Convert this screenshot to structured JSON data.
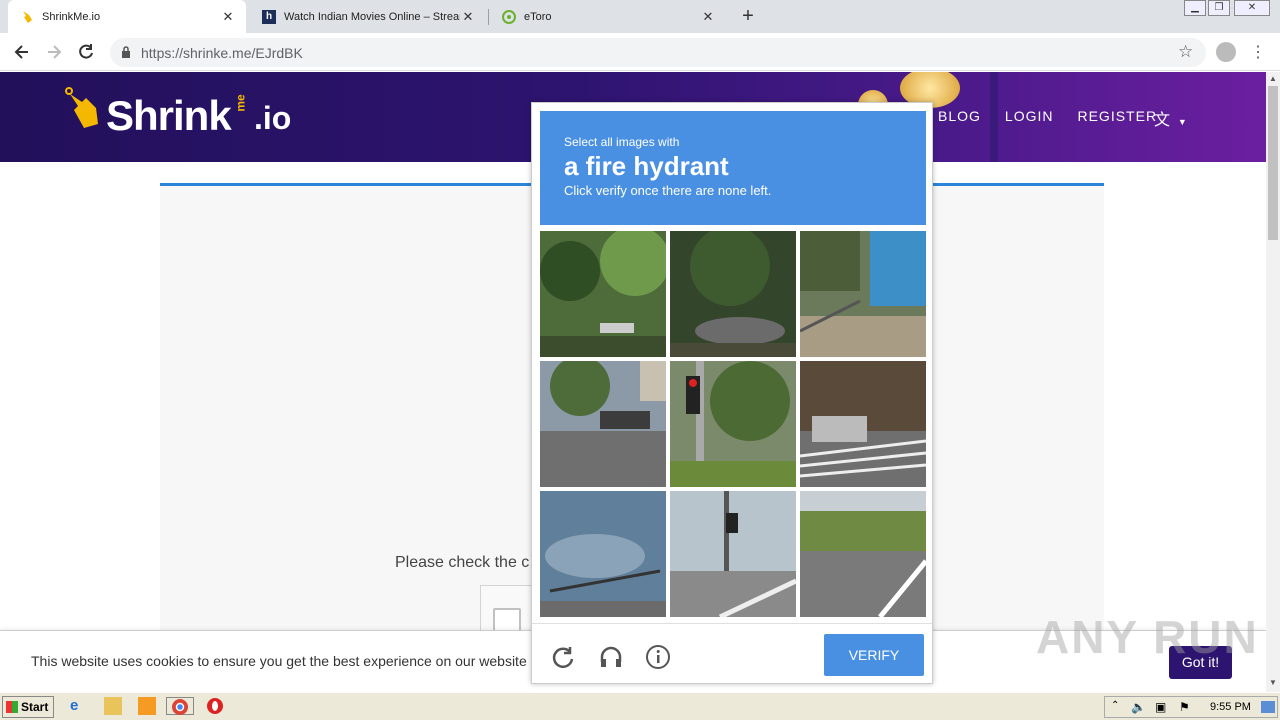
{
  "browser": {
    "tabs": [
      {
        "title": "ShrinkMe.io",
        "active": true
      },
      {
        "title": "Watch Indian Movies Online – Stream",
        "active": false
      },
      {
        "title": "eToro",
        "active": false
      }
    ],
    "url_host": "https://shrinke.me",
    "url_path": "/EJrdBK"
  },
  "site": {
    "logo_main": "Shrink",
    "logo_me": "me",
    "logo_io": ".io",
    "nav": [
      "BLOG",
      "LOGIN",
      "REGISTER"
    ],
    "check_text": "Please check the c"
  },
  "captcha": {
    "line1": "Select all images with",
    "line2": "a fire hydrant",
    "line3": "Click verify once there are none left.",
    "verify_label": "VERIFY",
    "tiles": [
      "trees-park",
      "debris-forest",
      "blue-truck",
      "parked-car",
      "traffic-light",
      "crosswalk-suv",
      "boat-trailer",
      "street-signal",
      "road-curve"
    ]
  },
  "cookie": {
    "text": "This website uses cookies to ensure you get the best experience on our website",
    "button": "Got it!"
  },
  "watermark": "ANY RUN",
  "taskbar": {
    "start": "Start",
    "clock": "9:55 PM"
  },
  "colors": {
    "header_primary": "#2d1470",
    "captcha_blue": "#4a90e2"
  }
}
